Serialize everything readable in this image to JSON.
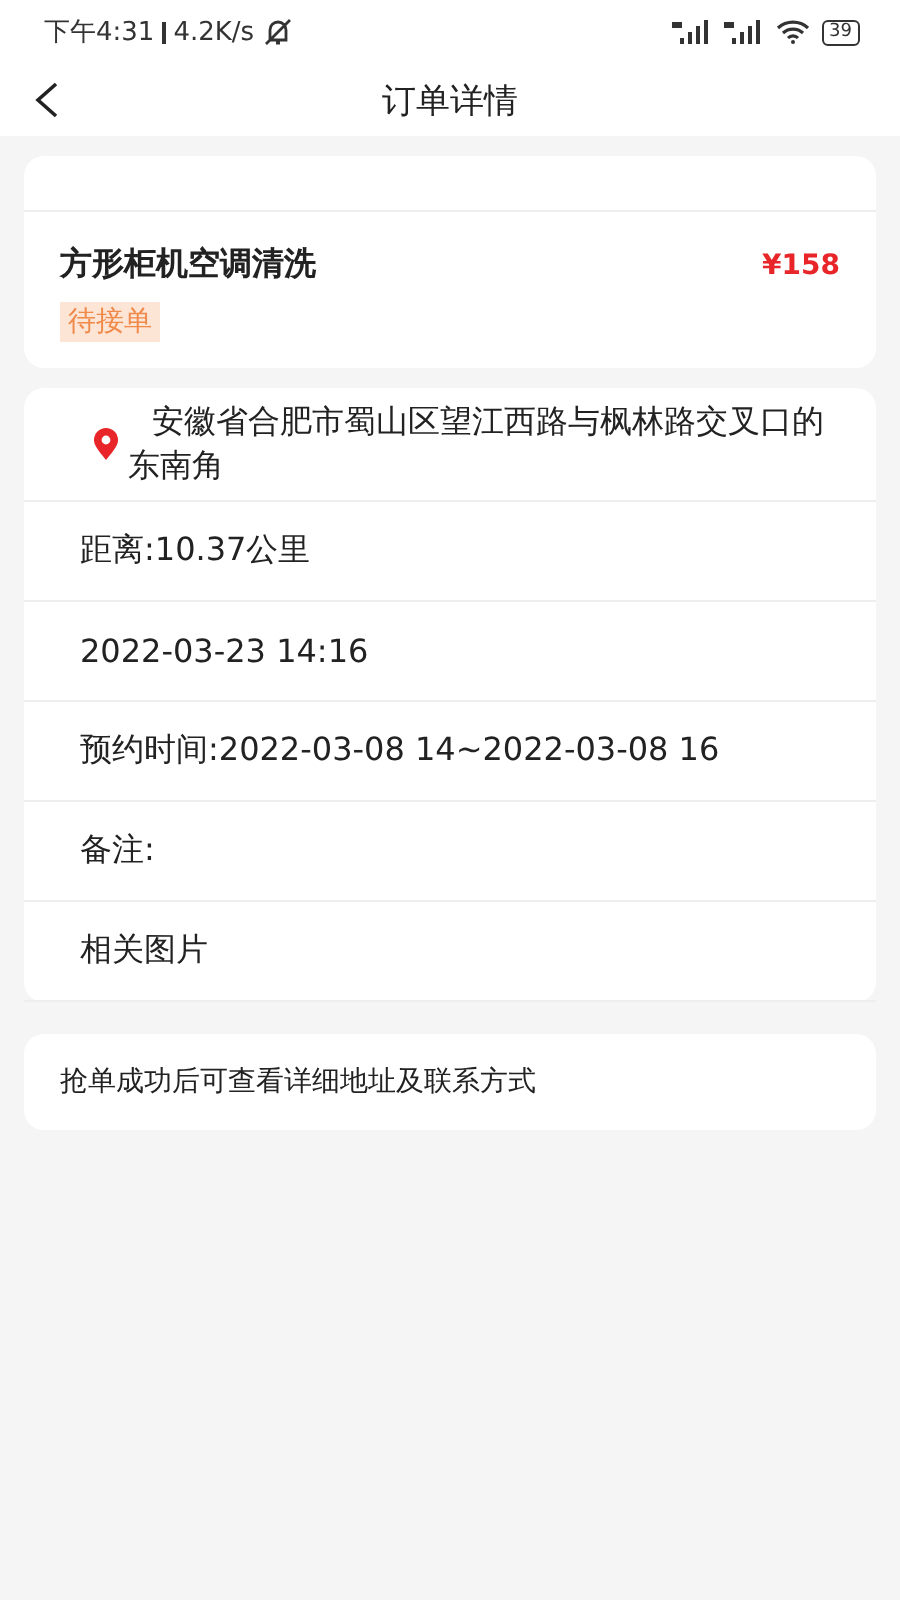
{
  "status_bar": {
    "time": "下午4:31",
    "speed": "4.2K/s",
    "battery": "39"
  },
  "header": {
    "title": "订单详情"
  },
  "order": {
    "title": "方形柜机空调清洗",
    "price": "¥158",
    "status": "待接单"
  },
  "address": "安徽省合肥市蜀山区望江西路与枫林路交叉口的东南角",
  "details": [
    {
      "text": "距离:10.37公里"
    },
    {
      "text": "2022-03-23 14:16"
    },
    {
      "text": "预约时间:2022-03-08 14~2022-03-08 16"
    },
    {
      "text": "备注:"
    },
    {
      "text": "相关图片"
    }
  ],
  "notice": "抢单成功后可查看详细地址及联系方式"
}
